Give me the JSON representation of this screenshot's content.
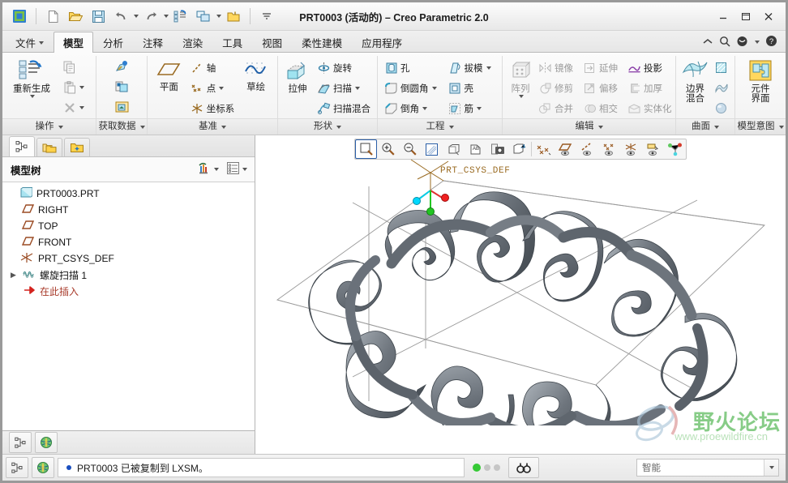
{
  "window": {
    "title": "PRT0003 (活动的) – Creo Parametric 2.0",
    "minimize": "—",
    "restore": "❐",
    "close": "✕"
  },
  "quick_access": [
    {
      "name": "app-logo-icon",
      "label": "Creo"
    },
    {
      "name": "new-file-icon",
      "label": "新建"
    },
    {
      "name": "open-file-icon",
      "label": "打开"
    },
    {
      "name": "save-icon",
      "label": "保存"
    },
    {
      "name": "undo-icon",
      "label": "撤销"
    },
    {
      "name": "redo-icon",
      "label": "重做"
    },
    {
      "name": "regenerate-icon",
      "label": "重新生成"
    },
    {
      "name": "window-switch-icon",
      "label": "窗口"
    },
    {
      "name": "close-window-icon",
      "label": "关闭"
    },
    {
      "name": "customize-qat-icon",
      "label": "自定义快速访问工具栏"
    }
  ],
  "tabs": [
    {
      "label": "文件",
      "active": false,
      "dropdown": true
    },
    {
      "label": "模型",
      "active": true,
      "dropdown": false
    },
    {
      "label": "分析",
      "active": false,
      "dropdown": false
    },
    {
      "label": "注释",
      "active": false,
      "dropdown": false
    },
    {
      "label": "渲染",
      "active": false,
      "dropdown": false
    },
    {
      "label": "工具",
      "active": false,
      "dropdown": false
    },
    {
      "label": "视图",
      "active": false,
      "dropdown": false
    },
    {
      "label": "柔性建模",
      "active": false,
      "dropdown": false
    },
    {
      "label": "应用程序",
      "active": false,
      "dropdown": false
    }
  ],
  "tab_right_icons": [
    {
      "name": "collapse-ribbon-icon"
    },
    {
      "name": "search-icon"
    },
    {
      "name": "account-icon"
    },
    {
      "name": "help-icon"
    }
  ],
  "ribbon": {
    "groups": [
      {
        "label": "操作",
        "big": [
          {
            "label": "重新生成",
            "icon": "regenerate-icon",
            "disabled": false,
            "dropdown": true
          }
        ],
        "small": [
          {
            "label": "",
            "icon": "copy-icon",
            "disabled": true,
            "dropdown": false
          },
          {
            "label": "",
            "icon": "paste-icon",
            "disabled": true,
            "dropdown": true
          },
          {
            "label": "",
            "icon": "delete-icon",
            "disabled": true,
            "dropdown": true
          }
        ]
      },
      {
        "label": "获取数据",
        "big": [],
        "small": [
          {
            "label": "",
            "icon": "import-icon",
            "disabled": false,
            "dropdown": false
          },
          {
            "label": "",
            "icon": "merge-icon",
            "disabled": false,
            "dropdown": false
          },
          {
            "label": "",
            "icon": "shrinkwrap-icon",
            "disabled": false,
            "dropdown": false
          }
        ]
      },
      {
        "label": "基准",
        "big": [
          {
            "label": "平面",
            "icon": "datum-plane-icon",
            "disabled": false,
            "dropdown": false
          }
        ],
        "small": [
          {
            "label": "轴",
            "icon": "datum-axis-icon",
            "disabled": false,
            "dropdown": false
          },
          {
            "label": "点",
            "icon": "datum-point-icon",
            "disabled": false,
            "dropdown": true
          },
          {
            "label": "坐标系",
            "icon": "datum-csys-icon",
            "disabled": false,
            "dropdown": false
          }
        ],
        "big2": [
          {
            "label": "草绘",
            "icon": "sketch-icon",
            "disabled": false,
            "dropdown": false
          }
        ]
      },
      {
        "label": "形状",
        "big": [
          {
            "label": "拉伸",
            "icon": "extrude-icon",
            "disabled": false,
            "dropdown": false
          }
        ],
        "small": [
          {
            "label": "旋转",
            "icon": "revolve-icon",
            "disabled": false,
            "dropdown": false
          },
          {
            "label": "扫描",
            "icon": "sweep-icon",
            "disabled": false,
            "dropdown": true
          },
          {
            "label": "扫描混合",
            "icon": "swept-blend-icon",
            "disabled": false,
            "dropdown": false
          }
        ]
      },
      {
        "label": "工程",
        "colA": [
          {
            "label": "孔",
            "icon": "hole-icon",
            "disabled": false,
            "dropdown": false
          },
          {
            "label": "倒圆角",
            "icon": "round-icon",
            "disabled": false,
            "dropdown": true
          },
          {
            "label": "倒角",
            "icon": "chamfer-icon",
            "disabled": false,
            "dropdown": true
          }
        ],
        "colB": [
          {
            "label": "拔模",
            "icon": "draft-icon",
            "disabled": false,
            "dropdown": true
          },
          {
            "label": "壳",
            "icon": "shell-icon",
            "disabled": false,
            "dropdown": false
          },
          {
            "label": "筋",
            "icon": "rib-icon",
            "disabled": false,
            "dropdown": true
          }
        ]
      },
      {
        "label": "编辑",
        "big": [
          {
            "label": "阵列",
            "icon": "pattern-icon",
            "disabled": true,
            "dropdown": true
          }
        ],
        "colA": [
          {
            "label": "镜像",
            "icon": "mirror-icon",
            "disabled": true,
            "dropdown": false
          },
          {
            "label": "修剪",
            "icon": "trim-icon",
            "disabled": true,
            "dropdown": false
          },
          {
            "label": "合并",
            "icon": "merge-surf-icon",
            "disabled": true,
            "dropdown": false
          }
        ],
        "colB": [
          {
            "label": "延伸",
            "icon": "extend-icon",
            "disabled": true,
            "dropdown": false
          },
          {
            "label": "偏移",
            "icon": "offset-icon",
            "disabled": true,
            "dropdown": false
          },
          {
            "label": "相交",
            "icon": "intersect-icon",
            "disabled": true,
            "dropdown": false
          }
        ],
        "colC": [
          {
            "label": "投影",
            "icon": "project-icon",
            "disabled": false,
            "dropdown": false
          },
          {
            "label": "加厚",
            "icon": "thicken-icon",
            "disabled": true,
            "dropdown": false
          },
          {
            "label": "实体化",
            "icon": "solidify-icon",
            "disabled": true,
            "dropdown": false
          }
        ]
      },
      {
        "label": "曲面",
        "big": [
          {
            "label": "边界混合",
            "icon": "boundary-blend-icon",
            "disabled": false,
            "dropdown": false
          }
        ],
        "small": [
          {
            "label": "",
            "icon": "fill-surface-icon",
            "disabled": false,
            "dropdown": false
          },
          {
            "label": "",
            "icon": "style-surface-icon",
            "disabled": false,
            "dropdown": false
          },
          {
            "label": "",
            "icon": "freestyle-icon",
            "disabled": false,
            "dropdown": false
          }
        ]
      },
      {
        "label": "模型意图",
        "big": [
          {
            "label": "元件界面",
            "icon": "component-interface-icon",
            "disabled": false,
            "dropdown": false
          }
        ],
        "small": []
      }
    ]
  },
  "nav_pane": {
    "pane_tabs": [
      {
        "name": "model-tree-tab",
        "active": true
      },
      {
        "name": "folder-browser-tab",
        "active": false
      },
      {
        "name": "favorites-tab",
        "active": false
      }
    ],
    "tree_title": "模型树",
    "header_buttons": [
      {
        "name": "tree-filter-icon"
      },
      {
        "name": "tree-settings-icon"
      }
    ],
    "tree": [
      {
        "label": "PRT0003.PRT",
        "icon": "part-icon",
        "indent": 0,
        "expander": ""
      },
      {
        "label": "RIGHT",
        "icon": "datum-plane-icon",
        "indent": 1,
        "expander": ""
      },
      {
        "label": "TOP",
        "icon": "datum-plane-icon",
        "indent": 1,
        "expander": ""
      },
      {
        "label": "FRONT",
        "icon": "datum-plane-icon",
        "indent": 1,
        "expander": ""
      },
      {
        "label": "PRT_CSYS_DEF",
        "icon": "datum-csys-icon",
        "indent": 1,
        "expander": ""
      },
      {
        "label": "螺旋扫描 1",
        "icon": "helical-sweep-icon",
        "indent": 1,
        "expander": "▶"
      },
      {
        "label": "在此插入",
        "icon": "insert-here-icon",
        "indent": 1,
        "expander": ""
      }
    ],
    "footer_buttons": [
      {
        "name": "tree-layout-icon"
      },
      {
        "name": "browser-globe-icon"
      }
    ]
  },
  "graphics_toolbar": [
    {
      "name": "refit-icon",
      "selected": true
    },
    {
      "name": "zoom-in-icon",
      "selected": false
    },
    {
      "name": "zoom-out-icon",
      "selected": false
    },
    {
      "name": "repaint-icon",
      "selected": false
    },
    {
      "name": "saved-views-icon",
      "selected": false
    },
    {
      "name": "view-manager-icon",
      "selected": false
    },
    {
      "name": "snapshot-icon",
      "selected": false
    },
    {
      "name": "perspective-icon",
      "selected": false
    },
    {
      "name": "datum-display-icon",
      "selected": false
    },
    {
      "name": "plane-display-icon",
      "selected": false
    },
    {
      "name": "axis-display-icon",
      "selected": false
    },
    {
      "name": "point-display-icon",
      "selected": false
    },
    {
      "name": "csys-display-icon",
      "selected": false
    },
    {
      "name": "annotation-display-icon",
      "selected": false
    },
    {
      "name": "spin-center-icon",
      "selected": false
    }
  ],
  "viewport": {
    "csys_label": "PRT_CSYS_DEF",
    "model_color": "#6e747c",
    "background": "#ffffff",
    "datum_line_color": "#9a9a9a",
    "axis_colors": {
      "x": "#00d8ff",
      "y": "#22c522",
      "z": "#f02020"
    }
  },
  "watermark": {
    "text": "野火论坛",
    "url": "www.proewildfire.cn",
    "text_color": "#3fae3f"
  },
  "status_bar": {
    "left_buttons": [
      {
        "name": "model-tree-toggle-icon"
      },
      {
        "name": "web-browser-toggle-icon"
      }
    ],
    "message": "PRT0003 已被复制到 LXSM。",
    "search_button": "search-glass-icon",
    "filter_value": "智能"
  }
}
